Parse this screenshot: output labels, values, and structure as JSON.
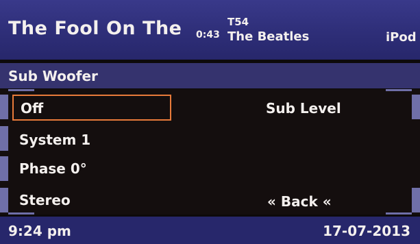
{
  "now_playing": {
    "title": "The Fool On The",
    "elapsed": "0:43",
    "track": "T54",
    "artist": "The Beatles",
    "source": "iPod"
  },
  "section": {
    "title": "Sub Woofer"
  },
  "menu": {
    "left_items": [
      {
        "label": "Off",
        "selected": true
      },
      {
        "label": "System 1",
        "selected": false
      },
      {
        "label": "Phase 0°",
        "selected": false
      },
      {
        "label": "Stereo",
        "selected": false
      }
    ],
    "sub_level_label": "Sub Level",
    "back_label": "« Back «"
  },
  "status": {
    "time": "9:24 pm",
    "date": "17-07-2013"
  },
  "colors": {
    "header_bg": "#2e2e78",
    "selection_border": "#e87a3a",
    "menu_bg": "#140e0e",
    "tab_accent": "#6f6fa8"
  }
}
